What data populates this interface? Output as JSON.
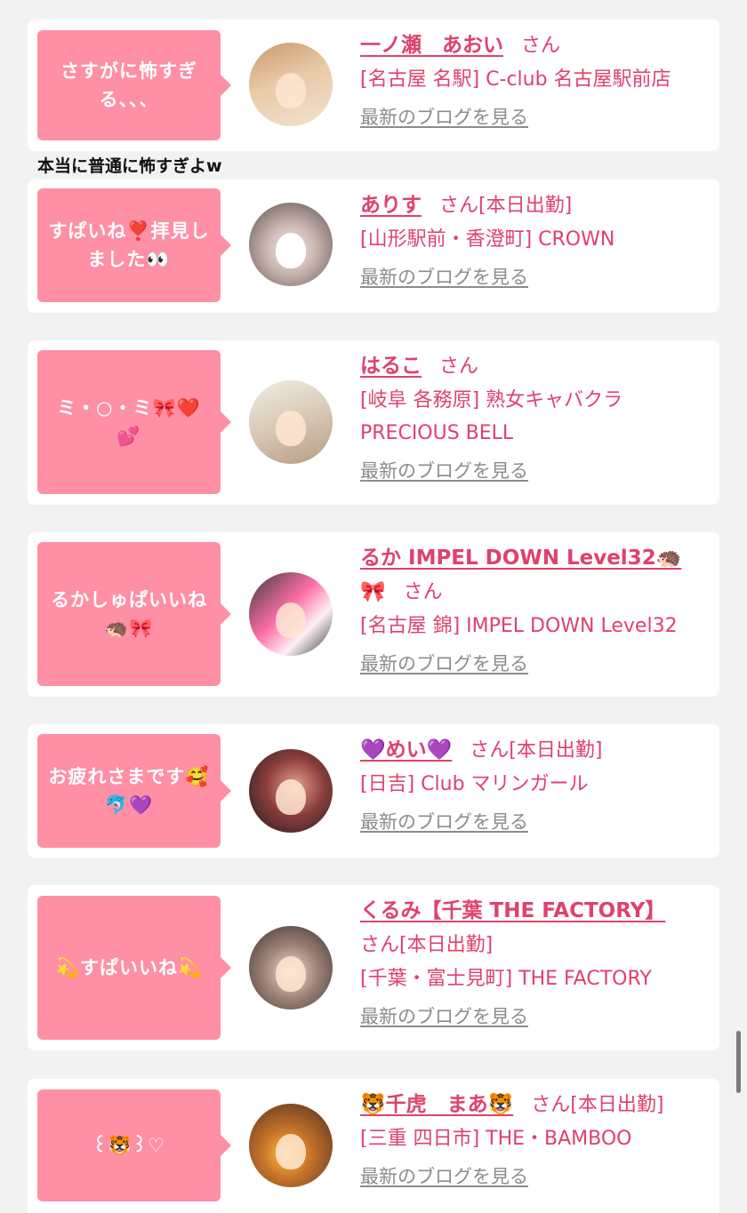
{
  "between_comment": "本当に普通に怖すぎよw",
  "blog_link_label": "最新のブログを見る",
  "colors": {
    "bubble": "#ff8fa5",
    "accent": "#e0416b",
    "link_gray": "#8c8c8c",
    "background": "#f2f2f2"
  },
  "cards": [
    {
      "bubble": "さすがに怖すぎ\nる、、、",
      "name": "一ノ瀬　あおい",
      "san": "さん",
      "shop_lines": [
        "[名古屋 名駅] C-club 名古屋駅前店"
      ]
    },
    {
      "bubble": "すぱいね❣️拝見し\nました👀",
      "name": "ありす",
      "san": "さん[本日出勤]",
      "shop_lines": [
        "[山形駅前・香澄町] CROWN"
      ]
    },
    {
      "bubble": "ミ・○・ミ🎀❤️💕",
      "name": "はるこ",
      "san": "さん",
      "shop_lines": [
        "[岐阜 各務原]  熟女キャバクラ",
        "PRECIOUS BELL"
      ]
    },
    {
      "bubble": "るかしゅぱいいね\n🦔🎀",
      "name": "るか IMPEL DOWN Level32🦔",
      "name2": "🎀",
      "san": "さん",
      "shop_lines": [
        "[名古屋 錦] IMPEL DOWN Level32"
      ]
    },
    {
      "bubble": "お疲れさまです🥰\n🐬💜",
      "name": "💜めい💜",
      "san": "さん[本日出勤]",
      "shop_lines": [
        "[日吉] Club マリンガール"
      ]
    },
    {
      "bubble": "💫すぱいいね💫",
      "name": "くるみ【千葉 THE FACTORY】",
      "san": "さん[本日出勤]",
      "shop_lines": [
        "[千葉・富士見町] THE FACTORY"
      ]
    },
    {
      "bubble": "꒰🐯꒱♡",
      "name": "🐯千虎　まあ🐯",
      "san": "さん[本日出勤]",
      "shop_lines": [
        "[三重 四日市] THE・BAMBOO"
      ]
    }
  ]
}
